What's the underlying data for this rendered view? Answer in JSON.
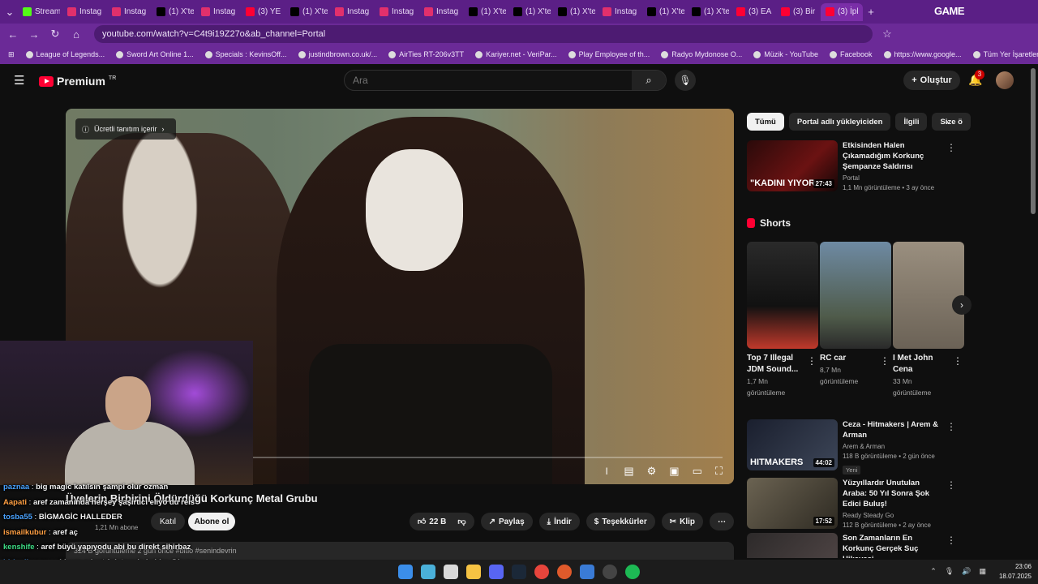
{
  "browser": {
    "tabs": [
      {
        "label": "Stream",
        "color": "#53fc18"
      },
      {
        "label": "Instag",
        "color": "#e1306c"
      },
      {
        "label": "Instag",
        "color": "#e1306c"
      },
      {
        "label": "(1) X'te",
        "color": "#000000"
      },
      {
        "label": "Instag",
        "color": "#e1306c"
      },
      {
        "label": "(3) YE",
        "color": "#ff0033"
      },
      {
        "label": "(1) X'te",
        "color": "#000000"
      },
      {
        "label": "Instag",
        "color": "#e1306c"
      },
      {
        "label": "Instag",
        "color": "#e1306c"
      },
      {
        "label": "Instag",
        "color": "#e1306c"
      },
      {
        "label": "(1) X'te",
        "color": "#000000"
      },
      {
        "label": "(1) X'te",
        "color": "#000000"
      },
      {
        "label": "(1) X'te",
        "color": "#000000"
      },
      {
        "label": "Instag",
        "color": "#e1306c"
      },
      {
        "label": "(1) X'te",
        "color": "#000000"
      },
      {
        "label": "(1) X'te",
        "color": "#000000"
      },
      {
        "label": "(3) EA",
        "color": "#ff0033"
      },
      {
        "label": "(3) Bir",
        "color": "#ff0033"
      },
      {
        "label": "(3) İpl",
        "color": "#ff0033"
      }
    ],
    "url": "youtube.com/watch?v=C4t9i19Z27o&ab_channel=Portal",
    "bookmarks": [
      "League of Legends...",
      "Sword Art Online 1...",
      "Specials : KevinsOff...",
      "justindbrown.co.uk/...",
      "AirTies RT-206v3TT",
      "Kariyer.net - VeriPar...",
      "Play Employee of th...",
      "Radyo Mydonose O...",
      "Müzik - YouTube",
      "Facebook",
      "https://www.google...",
      "Tüm Yer İşaretleri"
    ],
    "overlay_logo": "GAME"
  },
  "header": {
    "logo_text": "Premium",
    "logo_sup": "TR",
    "search_placeholder": "Ara",
    "create_label": "Oluştur",
    "notif_count": "3"
  },
  "player": {
    "promo_label": "Ücretli tanıtım içerir",
    "watermark": "bitlo"
  },
  "video": {
    "title": "Üyelerin Birbirini Öldürdüğü Korkunç Metal Grubu",
    "subscribers": "1,21 Mn abone",
    "join_label": "Katıl",
    "subscribe_label": "Abone ol",
    "likes": "22 B",
    "share_label": "Paylaş",
    "download_label": "İndir",
    "thanks_label": "Teşekkürler",
    "clip_label": "Klip",
    "desc_meta": "324 B görüntüleme  2 gün önce  #bitlo #senindevrin"
  },
  "chat": [
    {
      "user": "paznaa",
      "msg": "big magic katılsın şampi olur ozman",
      "color": "#4aa3ff"
    },
    {
      "user": "Aapati",
      "msg": "aref zamanında herşey şaşırtıcı eliyo du reis",
      "color": "#ff9f43"
    },
    {
      "user": "tosba55",
      "msg": "BİGMAGİC HALLEDER",
      "color": "#4aa3ff"
    },
    {
      "user": "ismailkubur",
      "msg": "aref aç",
      "color": "#ff9f43"
    },
    {
      "user": "kenshife",
      "msg": "aref büyü yapıyodu abi bu direkt sihirbaz",
      "color": "#3ddc84"
    },
    {
      "user": "birkedisever",
      "msg": "abi sen o kart fırlatmada kaldın @hype",
      "color": "#4aa3ff"
    }
  ],
  "chips": [
    "Tümü",
    "Portal adlı yükleyiciden",
    "İlgili",
    "Size ö"
  ],
  "recommendations": [
    {
      "title": "Etkisinden Halen Çıkamadığım Korkunç Şempanze Saldırısı",
      "channel": "Portal",
      "meta": "1,1 Mn görüntüleme • 3 ay önce",
      "duration": "27:43",
      "thumb_text": "\"KADINI YIYOR",
      "new": ""
    },
    {
      "title": "Ceza - Hitmakers | Arem & Arman",
      "channel": "Arem & Arman",
      "meta": "118 B görüntüleme • 2 gün önce",
      "duration": "44:02",
      "thumb_text": "HITMAKERS",
      "new": "Yeni"
    },
    {
      "title": "Yüzyıllardır Unutulan Araba: 50 Yıl Sonra Şok Edici Buluş!",
      "channel": "Ready Steady Go",
      "meta": "112 B görüntüleme • 2 ay önce",
      "duration": "17:52",
      "thumb_text": "",
      "new": ""
    },
    {
      "title": "Son Zamanların En Korkunç Gerçek Suç Hikayesi",
      "channel": "",
      "meta": "",
      "duration": "",
      "thumb_text": "ben karımı",
      "new": ""
    }
  ],
  "shorts": {
    "heading": "Shorts",
    "items": [
      {
        "title": "Top 7 Illegal JDM Sound...",
        "views": "1,7 Mn",
        "views_label": "görüntüleme"
      },
      {
        "title": "RC car",
        "views": "8,7 Mn",
        "views_label": "görüntüleme"
      },
      {
        "title": "I Met John Cena",
        "views": "33 Mn",
        "views_label": "görüntüleme"
      }
    ]
  },
  "taskbar": {
    "time": "23:06",
    "date": "18.07.2025"
  }
}
